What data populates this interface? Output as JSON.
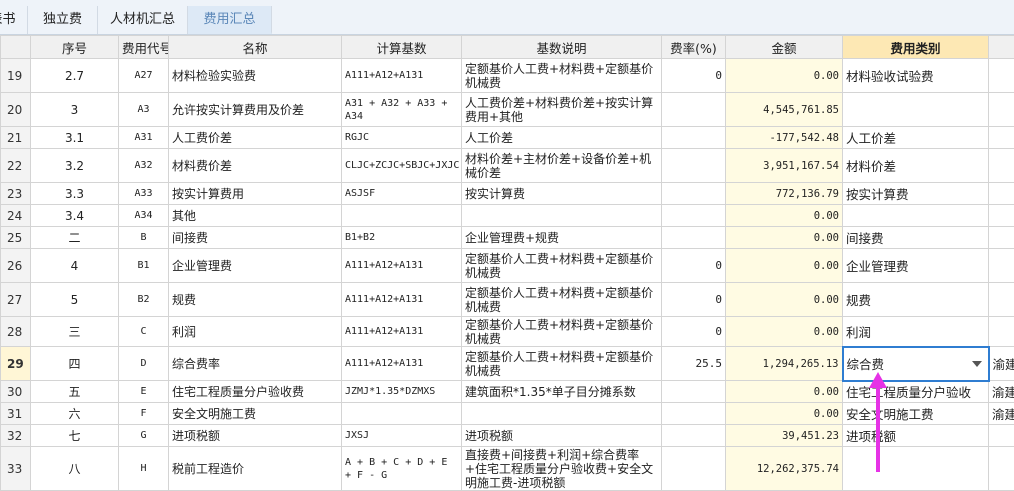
{
  "tabs": [
    {
      "label": "表书"
    },
    {
      "label": "独立费"
    },
    {
      "label": "人材机汇总"
    },
    {
      "label": "费用汇总"
    }
  ],
  "columns": [
    "",
    "序号",
    "费用代号",
    "名称",
    "计算基数",
    "基数说明",
    "费率(%)",
    "金额",
    "费用类别",
    ""
  ],
  "rows": [
    {
      "num": "19",
      "seq": "2.7",
      "code": "A27",
      "name": "材料检验实验费",
      "formula": "A111+A12+A131",
      "desc": "定额基价人工费+材料费+定额基价机械费",
      "rate": "0",
      "amount": "0.00",
      "cat": "材料验收试验费",
      "extra": ""
    },
    {
      "num": "20",
      "seq": "3",
      "code": "A3",
      "name": "允许按实计算费用及价差",
      "formula": "A31 + A32 + A33 + A34",
      "desc": "人工费价差+材料费价差+按实计算费用+其他",
      "rate": "",
      "amount": "4,545,761.85",
      "cat": "",
      "extra": ""
    },
    {
      "num": "21",
      "seq": "3.1",
      "code": "A31",
      "name": "人工费价差",
      "formula": "RGJC",
      "desc": "人工价差",
      "rate": "",
      "amount": "-177,542.48",
      "cat": "人工价差",
      "extra": ""
    },
    {
      "num": "22",
      "seq": "3.2",
      "code": "A32",
      "name": "材料费价差",
      "formula": "CLJC+ZCJC+SBJC+JXJC",
      "desc": "材料价差+主材价差+设备价差+机械价差",
      "rate": "",
      "amount": "3,951,167.54",
      "cat": "材料价差",
      "extra": ""
    },
    {
      "num": "23",
      "seq": "3.3",
      "code": "A33",
      "name": "按实计算费用",
      "formula": "ASJSF",
      "desc": "按实计算费",
      "rate": "",
      "amount": "772,136.79",
      "cat": "按实计算费",
      "extra": ""
    },
    {
      "num": "24",
      "seq": "3.4",
      "code": "A34",
      "name": "其他",
      "formula": "",
      "desc": "",
      "rate": "",
      "amount": "0.00",
      "cat": "",
      "extra": ""
    },
    {
      "num": "25",
      "seq": "二",
      "code": "B",
      "name": "间接费",
      "formula": "B1+B2",
      "desc": "企业管理费+规费",
      "rate": "",
      "amount": "0.00",
      "cat": "间接费",
      "extra": ""
    },
    {
      "num": "26",
      "seq": "4",
      "code": "B1",
      "name": "企业管理费",
      "formula": "A111+A12+A131",
      "desc": "定额基价人工费+材料费+定额基价机械费",
      "rate": "0",
      "amount": "0.00",
      "cat": "企业管理费",
      "extra": ""
    },
    {
      "num": "27",
      "seq": "5",
      "code": "B2",
      "name": "规费",
      "formula": "A111+A12+A131",
      "desc": "定额基价人工费+材料费+定额基价机械费",
      "rate": "0",
      "amount": "0.00",
      "cat": "规费",
      "extra": ""
    },
    {
      "num": "28",
      "seq": "三",
      "code": "C",
      "name": "利润",
      "formula": "A111+A12+A131",
      "desc": "定额基价人工费+材料费+定额基价机械费",
      "rate": "0",
      "amount": "0.00",
      "cat": "利润",
      "extra": ""
    },
    {
      "num": "29",
      "seq": "四",
      "code": "D",
      "name": "综合费率",
      "formula": "A111+A12+A131",
      "desc": "定额基价人工费+材料费+定额基价机械费",
      "rate": "25.5",
      "amount": "1,294,265.13",
      "cat": "综合费",
      "extra": "渝建"
    },
    {
      "num": "30",
      "seq": "五",
      "code": "E",
      "name": "住宅工程质量分户验收费",
      "formula": "JZMJ*1.35*DZMXS",
      "desc": "建筑面积*1.35*单子目分摊系数",
      "rate": "",
      "amount": "0.00",
      "cat": "住宅工程质量分户验收",
      "extra": "渝建"
    },
    {
      "num": "31",
      "seq": "六",
      "code": "F",
      "name": "安全文明施工费",
      "formula": "",
      "desc": "",
      "rate": "",
      "amount": "0.00",
      "cat": "安全文明施工费",
      "extra": "渝建"
    },
    {
      "num": "32",
      "seq": "七",
      "code": "G",
      "name": "进项税额",
      "formula": "JXSJ",
      "desc": "进项税额",
      "rate": "",
      "amount": "39,451.23",
      "cat": "进项税额",
      "extra": ""
    },
    {
      "num": "33",
      "seq": "八",
      "code": "H",
      "name": "税前工程造价",
      "formula": "A + B + C + D + E + F - G",
      "desc": "直接费+间接费+利润+综合费率+住宅工程质量分户验收费+安全文明施工费-进项税额",
      "rate": "",
      "amount": "12,262,375.74",
      "cat": "",
      "extra": ""
    }
  ],
  "selected_row": "29",
  "colors": {
    "accent": "#2f7dd1",
    "amount_bg": "#fffbe3",
    "category_header_bg": "#fde8b4",
    "annotation_arrow": "#e632e6"
  }
}
